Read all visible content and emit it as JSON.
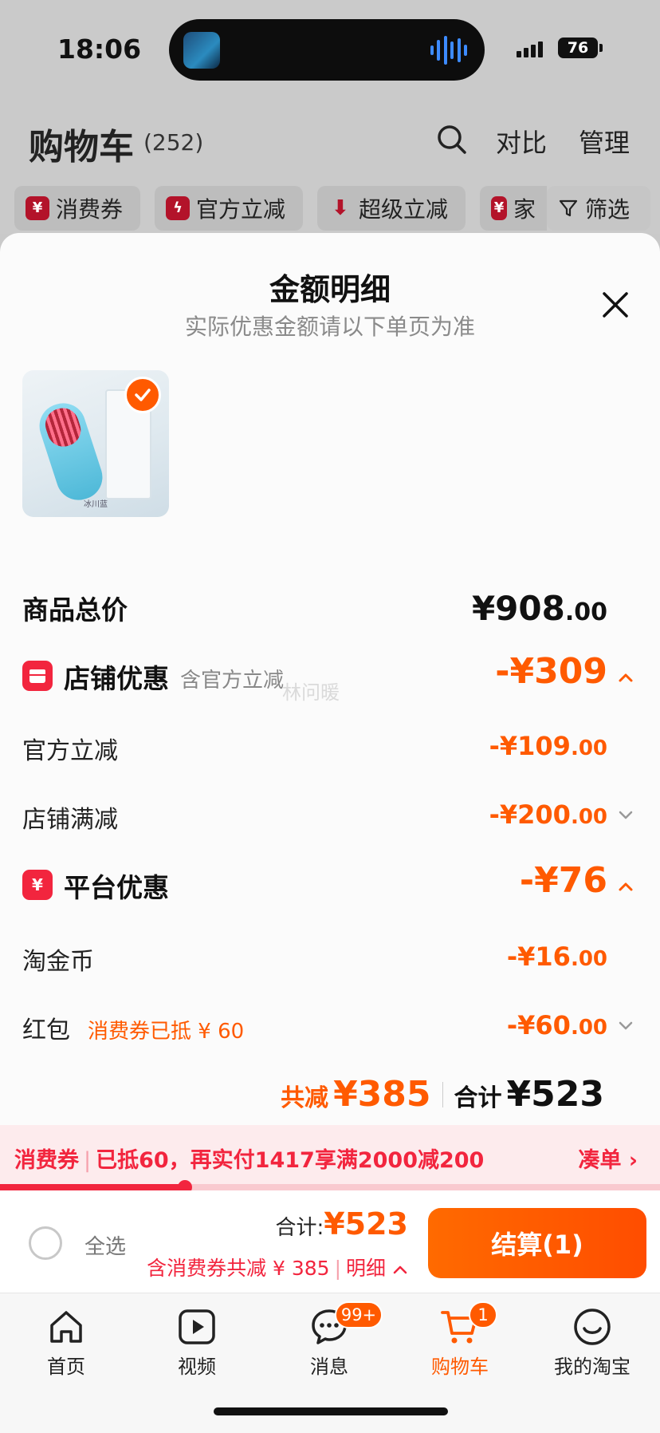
{
  "status_bar": {
    "time": "18:06",
    "battery": "76"
  },
  "header": {
    "title": "购物车",
    "count": "(252)",
    "compare": "对比",
    "manage": "管理"
  },
  "filters": [
    {
      "icon": "coupon-icon",
      "label": "消费券"
    },
    {
      "icon": "flash-icon",
      "label": "官方立减"
    },
    {
      "icon": "down-arrow-icon",
      "label": "超级立减"
    },
    {
      "icon": "coupon-icon",
      "label": "家"
    },
    {
      "icon": "filter-icon",
      "label": "筛选"
    }
  ],
  "sheet": {
    "title": "金额明细",
    "subtitle": "实际优惠金额请以下单页为准",
    "product_caption": "冰川蓝",
    "total_label": "商品总价",
    "total_main": "¥908",
    "total_dec": ".00",
    "store": {
      "title": "店铺优惠",
      "note": "含官方立减",
      "amount": "-¥309",
      "items": [
        {
          "label": "官方立减",
          "amount": "-¥109",
          "dec": ".00"
        },
        {
          "label": "店铺满减",
          "amount": "-¥200",
          "dec": ".00"
        }
      ]
    },
    "watermark": "林问暖",
    "platform": {
      "title": "平台优惠",
      "amount": "-¥76",
      "items": [
        {
          "label": "淘金币",
          "amount": "-¥16",
          "dec": ".00"
        },
        {
          "label": "红包",
          "note": "消费券已抵 ¥ 60",
          "amount": "-¥60",
          "dec": ".00"
        }
      ]
    },
    "summary": {
      "saved_label": "共减",
      "saved_value": "¥385",
      "total_label": "合计",
      "total_value": "¥523"
    }
  },
  "coupon_strip": {
    "tag": "消费券",
    "text": "已抵60，再实付1417享满2000减200",
    "link": "凑单 ›",
    "progress": 0.28
  },
  "checkout": {
    "select_all": "全选",
    "total_label": "合计:",
    "total_value": "¥523",
    "note": "含消费券共减 ¥ 385",
    "detail": "明细",
    "button": "结算(1)"
  },
  "tabbar": [
    {
      "label": "首页",
      "icon": "home-icon"
    },
    {
      "label": "视频",
      "icon": "video-icon"
    },
    {
      "label": "消息",
      "icon": "message-icon",
      "badge": "99+"
    },
    {
      "label": "购物车",
      "icon": "cart-icon",
      "badge": "1",
      "active": true
    },
    {
      "label": "我的淘宝",
      "icon": "profile-icon"
    }
  ],
  "colors": {
    "accent": "#ff5a00",
    "red": "#f2253e"
  }
}
